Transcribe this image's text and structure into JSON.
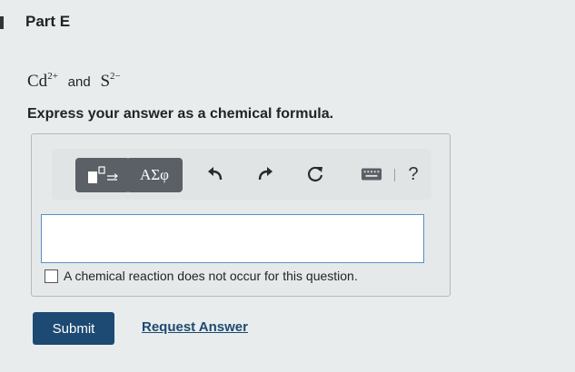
{
  "part": {
    "title": "Part E"
  },
  "question": {
    "ion1_base": "Cd",
    "ion1_charge": "2+",
    "conjunction": "and",
    "ion2_base": "S",
    "ion2_charge": "2−",
    "instruction": "Express your answer as a chemical formula."
  },
  "toolbar": {
    "symbols_label": "ΑΣφ",
    "help_label": "?"
  },
  "answer": {
    "value": ""
  },
  "checkbox": {
    "label": "A chemical reaction does not occur for this question.",
    "checked": false
  },
  "actions": {
    "submit_label": "Submit",
    "request_answer_label": "Request Answer"
  },
  "colors": {
    "submit_bg": "#1c4a73",
    "toolbar_button_bg": "#5b6066",
    "input_border": "#5a8fc7"
  }
}
